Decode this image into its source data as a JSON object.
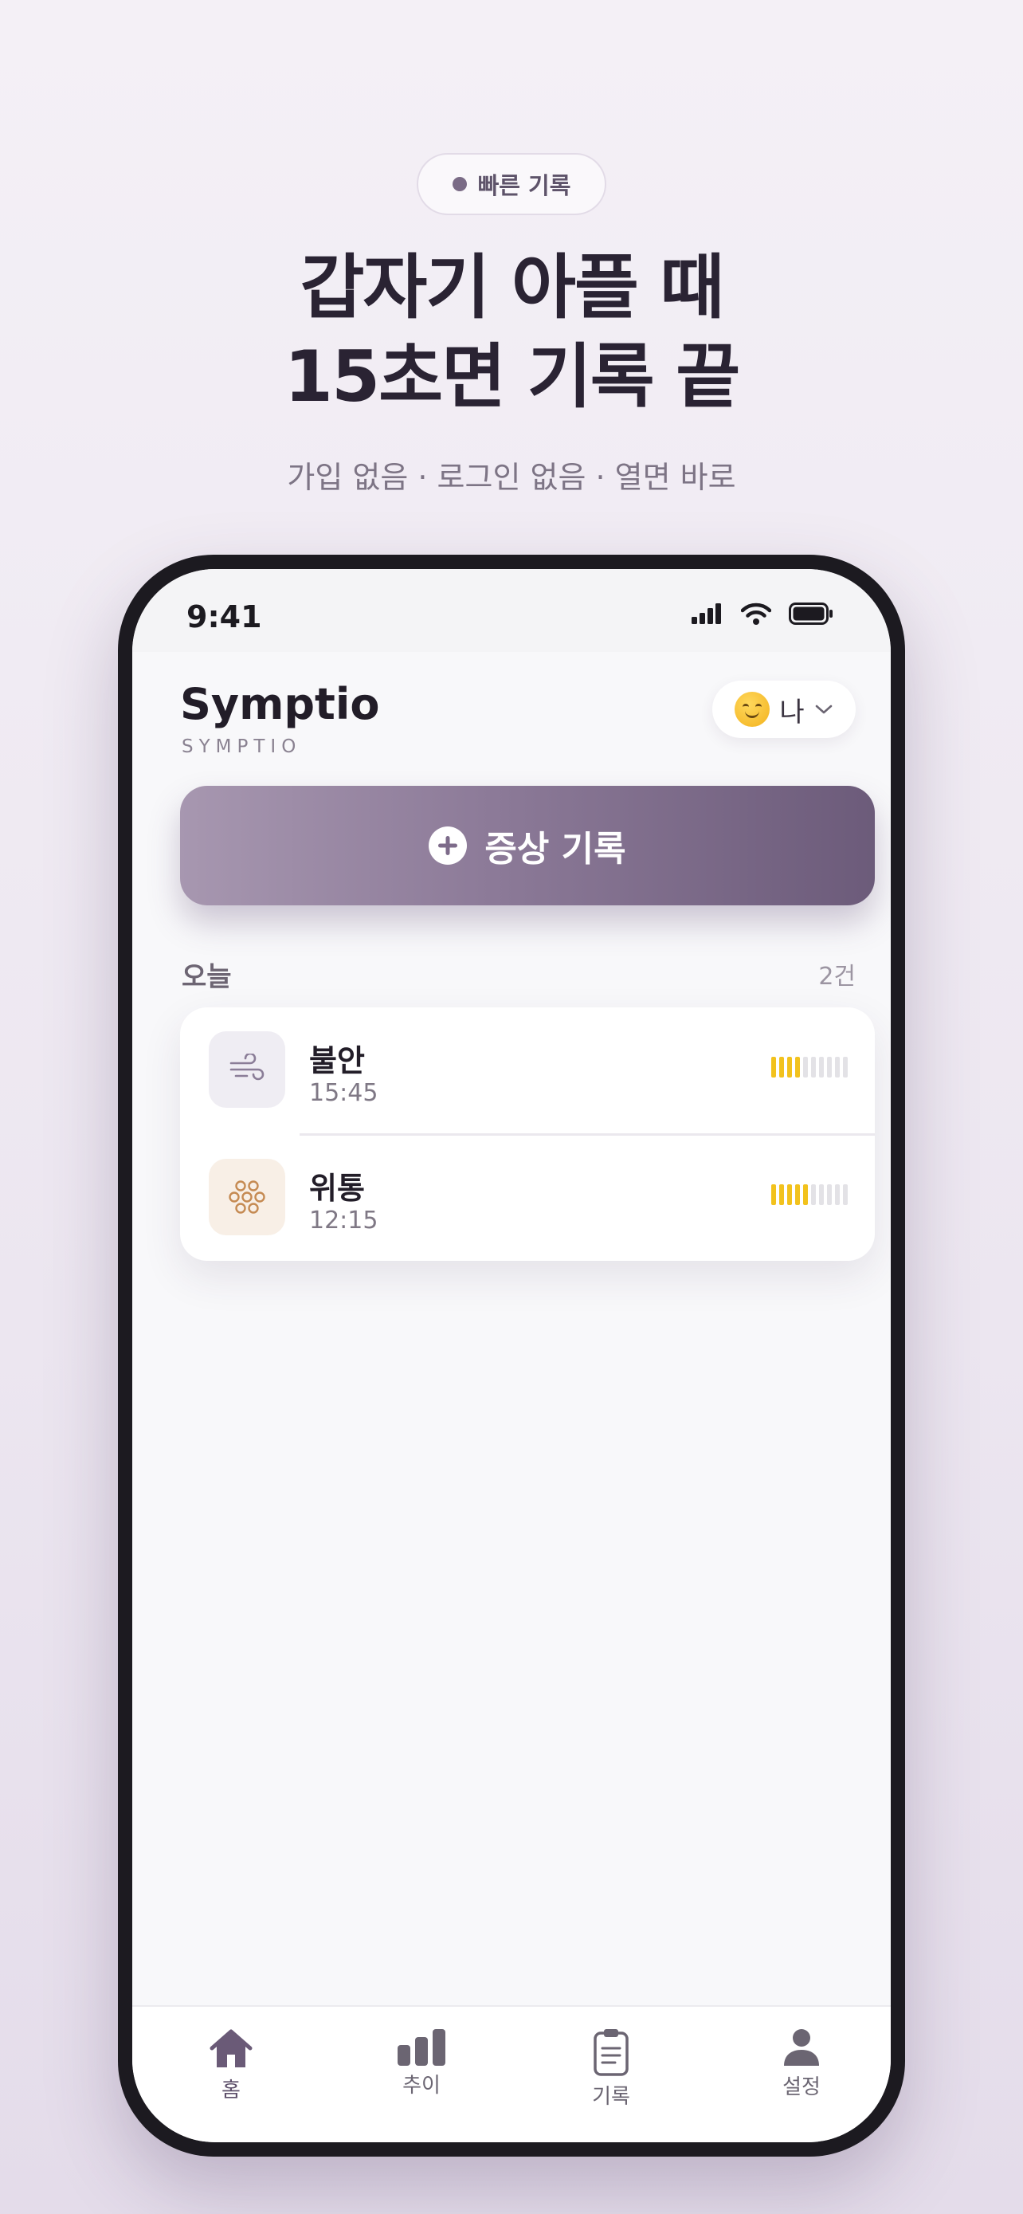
{
  "hero": {
    "badge": "빠른 기록",
    "title_line1": "갑자기 아플 때",
    "title_line2": "15초면 기록 끝",
    "subtitle": "가입 없음 · 로그인 없음 · 열면 바로"
  },
  "status_bar": {
    "time": "9:41"
  },
  "app": {
    "title": "Symptio",
    "subtitle": "SYMPTIO",
    "profile_name": "나",
    "record_button_label": "증상 기록"
  },
  "today": {
    "title": "오늘",
    "count": "2건",
    "entries": [
      {
        "name": "불안",
        "time": "15:45",
        "icon": "wind-icon",
        "severity": 4,
        "severity_max": 10
      },
      {
        "name": "위통",
        "time": "12:15",
        "icon": "knot-icon",
        "severity": 5,
        "severity_max": 10
      }
    ]
  },
  "tabs": [
    {
      "label": "홈",
      "icon": "home-icon",
      "active": true
    },
    {
      "label": "추이",
      "icon": "bar-chart-icon",
      "active": false
    },
    {
      "label": "기록",
      "icon": "clipboard-icon",
      "active": false
    },
    {
      "label": "설정",
      "icon": "person-icon",
      "active": false
    }
  ],
  "colors": {
    "accent": "#7d6b8a",
    "severity_on": "#f2c21d",
    "severity_off": "#e3e2e6"
  }
}
